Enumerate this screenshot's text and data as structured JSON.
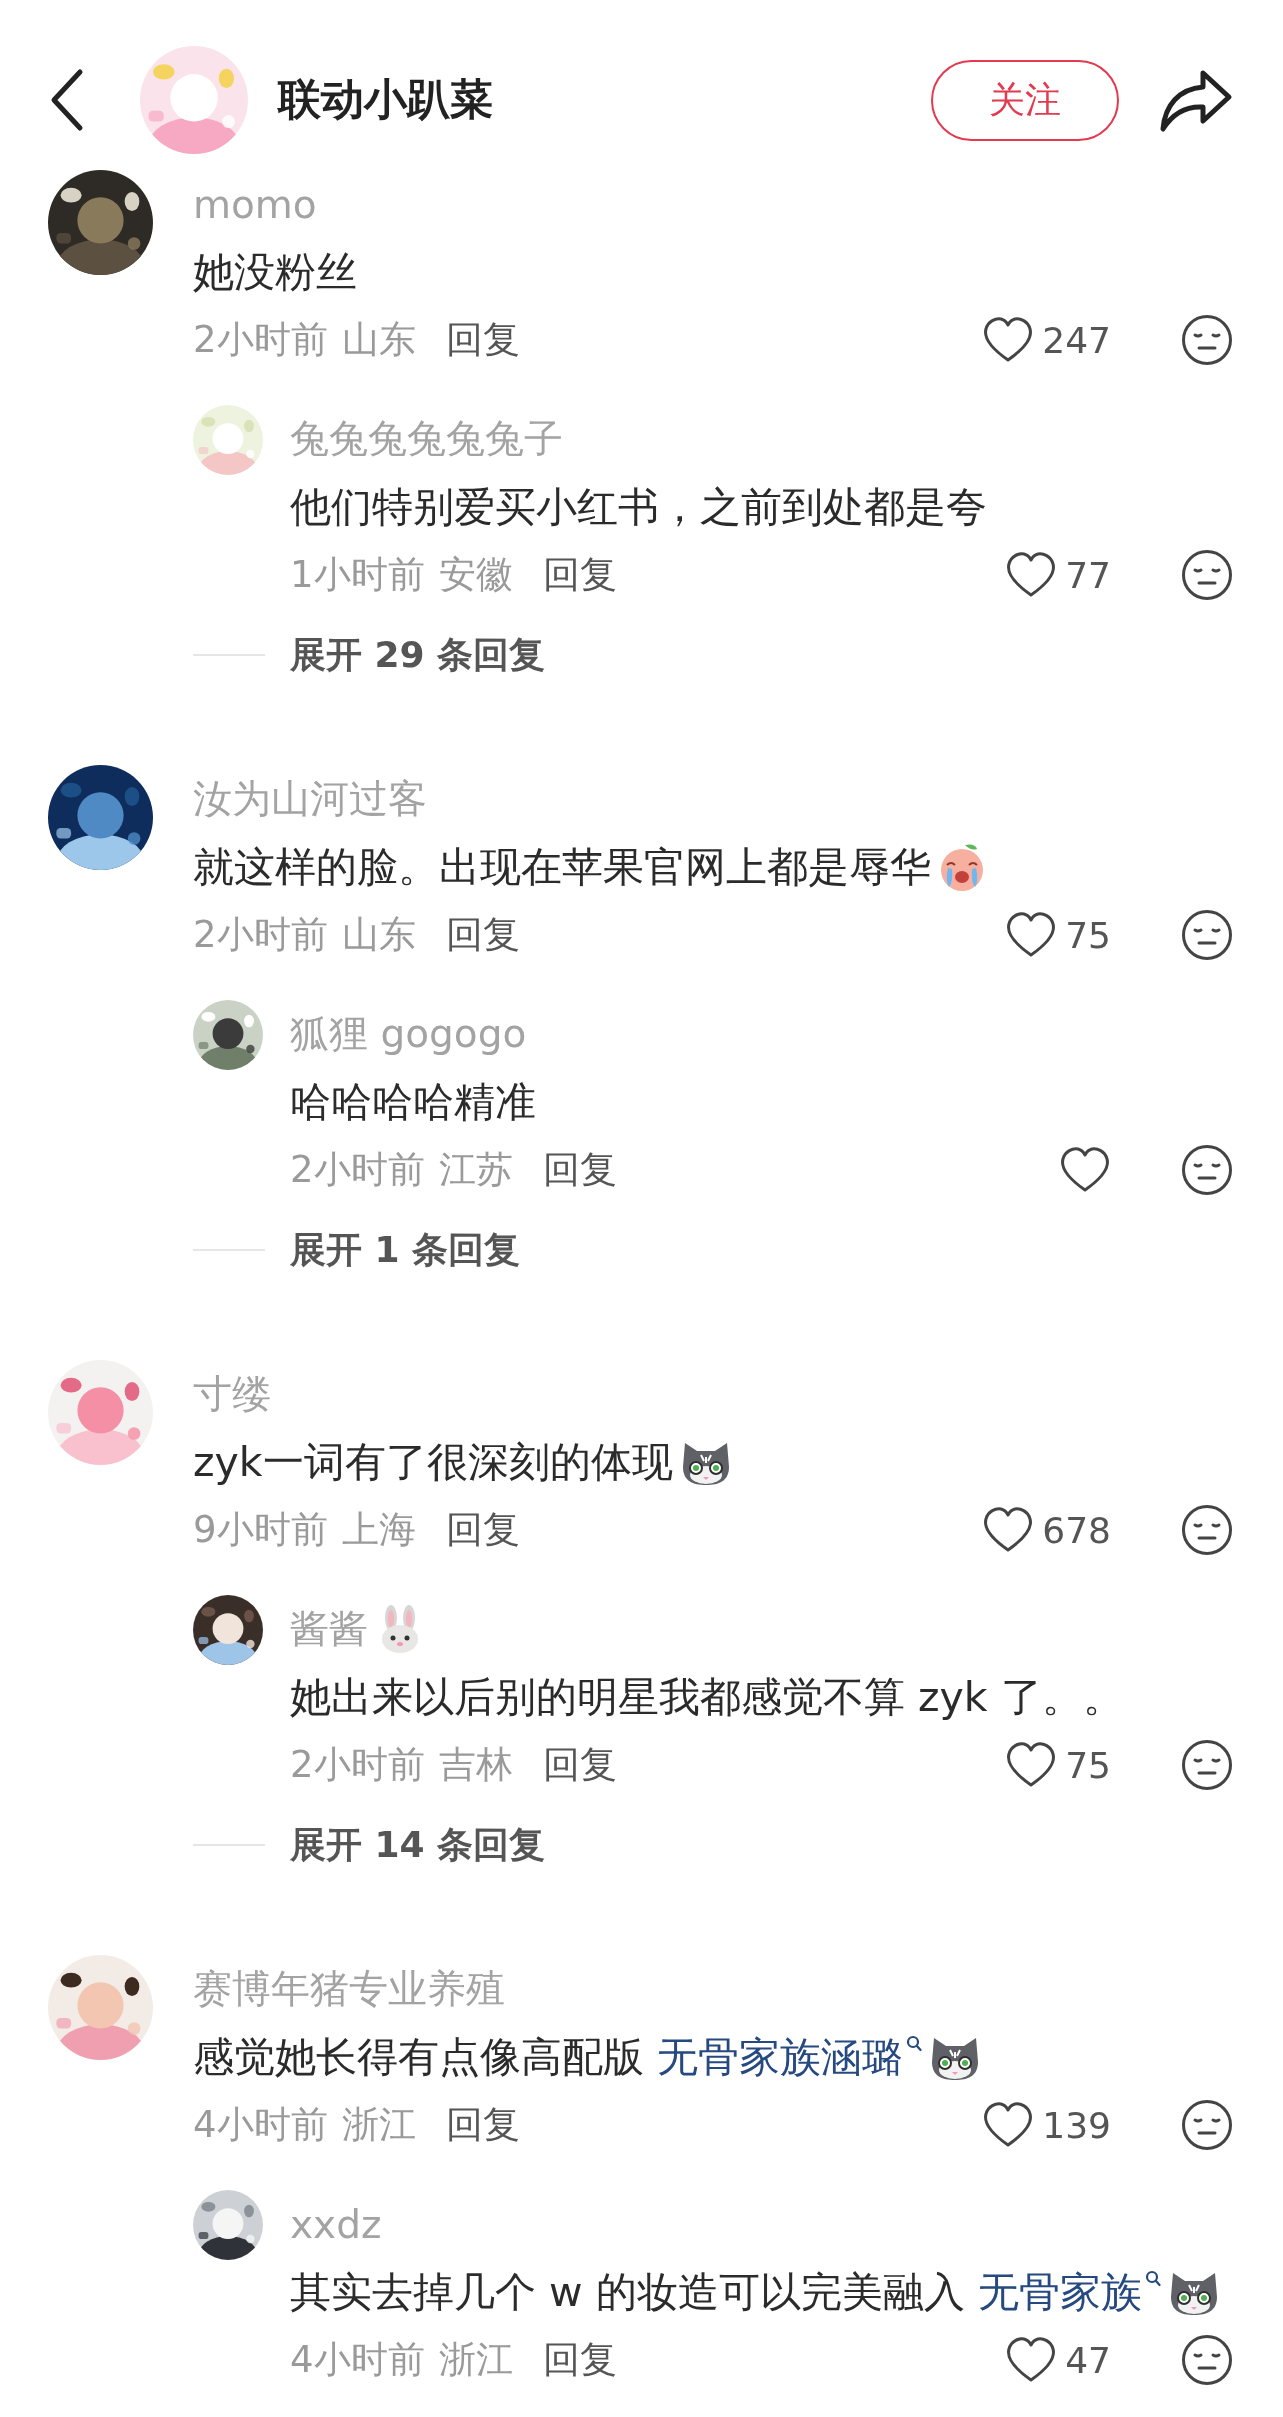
{
  "header": {
    "title": "联动小趴菜",
    "follow_button": "关注"
  },
  "comments": [
    {
      "user": "momo",
      "body": [
        {
          "kind": "text",
          "text": "她没粉丝"
        }
      ],
      "time": "2小时前",
      "location": "山东",
      "reply_label": "回复",
      "likes": "247",
      "replies": [
        {
          "user": "兔兔兔兔兔兔子",
          "body": [
            {
              "kind": "text",
              "text": "他们特别爱买小红书，之前到处都是夸"
            }
          ],
          "time": "1小时前",
          "location": "安徽",
          "reply_label": "回复",
          "likes": "77"
        }
      ],
      "expand": "展开 29 条回复"
    },
    {
      "user": "汝为山河过客",
      "body": [
        {
          "kind": "text",
          "text": "就这样的脸。出现在苹果官网上都是辱华"
        },
        {
          "kind": "peach"
        }
      ],
      "time": "2小时前",
      "location": "山东",
      "reply_label": "回复",
      "likes": "75",
      "replies": [
        {
          "user": "狐狸 gogogo",
          "body": [
            {
              "kind": "text",
              "text": "哈哈哈哈精准"
            }
          ],
          "time": "2小时前",
          "location": "江苏",
          "reply_label": "回复"
        }
      ],
      "expand": "展开 1 条回复"
    },
    {
      "user": "寸缕",
      "body": [
        {
          "kind": "text",
          "text": "zyk一词有了很深刻的体现"
        },
        {
          "kind": "cat"
        }
      ],
      "time": "9小时前",
      "location": "上海",
      "reply_label": "回复",
      "likes": "678",
      "replies": [
        {
          "user": "酱酱",
          "badges": [
            {
              "kind": "rabbit"
            }
          ],
          "body": [
            {
              "kind": "text",
              "text": "她出来以后别的明星我都感觉不算 zyk 了。。"
            }
          ],
          "time": "2小时前",
          "location": "吉林",
          "reply_label": "回复",
          "likes": "75"
        }
      ],
      "expand": "展开 14 条回复"
    },
    {
      "user": "赛博年猪专业养殖",
      "body": [
        {
          "kind": "text",
          "text": "感觉她长得有点像高配版 "
        },
        {
          "kind": "link",
          "text": "无骨家族涵璐"
        },
        {
          "kind": "cat"
        }
      ],
      "time": "4小时前",
      "location": "浙江",
      "reply_label": "回复",
      "likes": "139",
      "replies": [
        {
          "user": "xxdz",
          "body": [
            {
              "kind": "text",
              "text": "其实去掉几个 w 的妆造可以完美融入 "
            },
            {
              "kind": "link",
              "text": "无骨家族"
            },
            {
              "kind": "cat"
            }
          ],
          "time": "4小时前",
          "location": "浙江",
          "reply_label": "回复",
          "likes": "47"
        }
      ]
    }
  ]
}
